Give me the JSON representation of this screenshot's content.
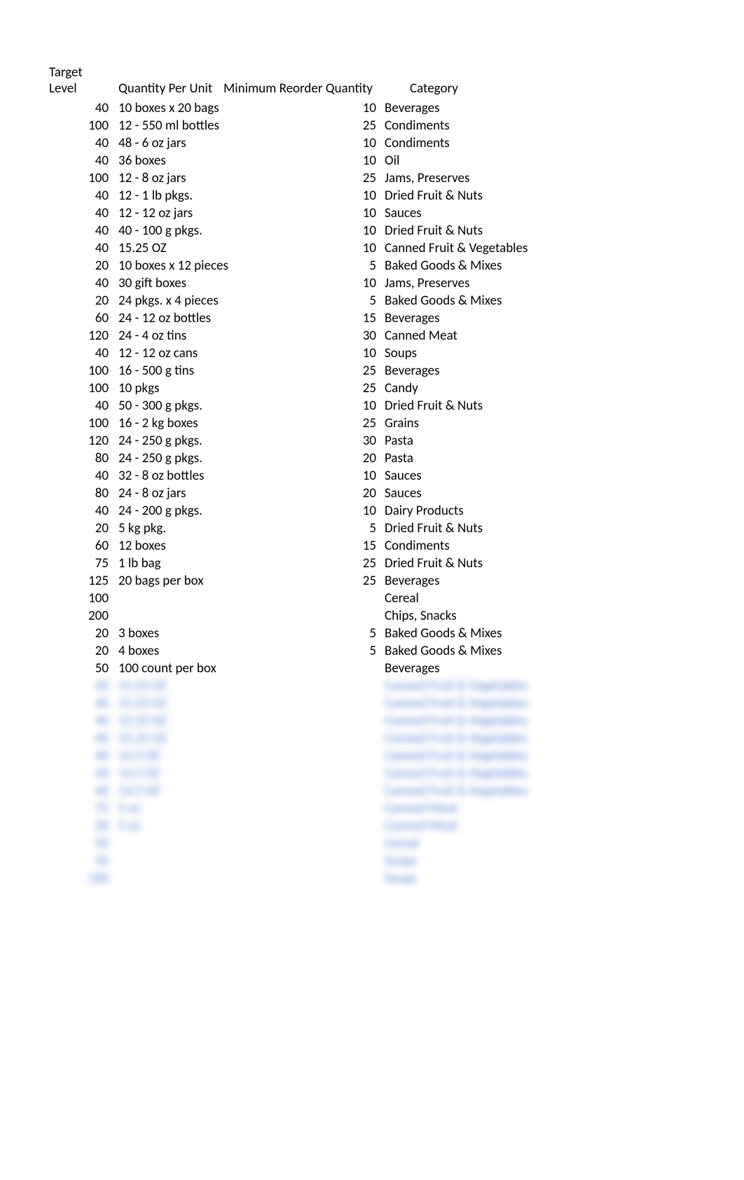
{
  "headers": {
    "target_level": "Target Level",
    "quantity_per_unit": "Quantity Per Unit",
    "min_reorder_qty": "Minimum Reorder Quantity",
    "category": "Category"
  },
  "rows": [
    {
      "target": "40",
      "qpu": "10 boxes x 20 bags",
      "mrq": "10",
      "cat": "Beverages",
      "b": false
    },
    {
      "target": "100",
      "qpu": "12 - 550 ml bottles",
      "mrq": "25",
      "cat": "Condiments",
      "b": false
    },
    {
      "target": "40",
      "qpu": "48 - 6 oz jars",
      "mrq": "10",
      "cat": "Condiments",
      "b": false
    },
    {
      "target": "40",
      "qpu": "36 boxes",
      "mrq": "10",
      "cat": "Oil",
      "b": false
    },
    {
      "target": "100",
      "qpu": "12 - 8 oz jars",
      "mrq": "25",
      "cat": "Jams, Preserves",
      "b": false
    },
    {
      "target": "40",
      "qpu": "12 - 1 lb pkgs.",
      "mrq": "10",
      "cat": "Dried Fruit & Nuts",
      "b": false
    },
    {
      "target": "40",
      "qpu": "12 - 12 oz jars",
      "mrq": "10",
      "cat": "Sauces",
      "b": false
    },
    {
      "target": "40",
      "qpu": "40 - 100 g pkgs.",
      "mrq": "10",
      "cat": "Dried Fruit & Nuts",
      "b": false
    },
    {
      "target": "40",
      "qpu": "15.25 OZ",
      "mrq": "10",
      "cat": "Canned Fruit & Vegetables",
      "b": false
    },
    {
      "target": "20",
      "qpu": "10 boxes x 12 pieces",
      "mrq": "5",
      "cat": "Baked Goods & Mixes",
      "b": false
    },
    {
      "target": "40",
      "qpu": "30 gift boxes",
      "mrq": "10",
      "cat": "Jams, Preserves",
      "b": false
    },
    {
      "target": "20",
      "qpu": "24 pkgs. x 4 pieces",
      "mrq": "5",
      "cat": "Baked Goods & Mixes",
      "b": false
    },
    {
      "target": "60",
      "qpu": "24 - 12 oz bottles",
      "mrq": "15",
      "cat": "Beverages",
      "b": false
    },
    {
      "target": "120",
      "qpu": "24 - 4 oz tins",
      "mrq": "30",
      "cat": "Canned Meat",
      "b": false
    },
    {
      "target": "40",
      "qpu": "12 - 12 oz cans",
      "mrq": "10",
      "cat": "Soups",
      "b": false
    },
    {
      "target": "100",
      "qpu": "16 - 500 g tins",
      "mrq": "25",
      "cat": "Beverages",
      "b": false
    },
    {
      "target": "100",
      "qpu": "10 pkgs",
      "mrq": "25",
      "cat": "Candy",
      "b": false
    },
    {
      "target": "40",
      "qpu": "50 - 300 g pkgs.",
      "mrq": "10",
      "cat": "Dried Fruit & Nuts",
      "b": false
    },
    {
      "target": "100",
      "qpu": "16 - 2 kg boxes",
      "mrq": "25",
      "cat": "Grains",
      "b": false
    },
    {
      "target": "120",
      "qpu": "24 - 250 g pkgs.",
      "mrq": "30",
      "cat": "Pasta",
      "b": false
    },
    {
      "target": "80",
      "qpu": "24 - 250 g pkgs.",
      "mrq": "20",
      "cat": "Pasta",
      "b": false
    },
    {
      "target": "40",
      "qpu": "32 - 8 oz bottles",
      "mrq": "10",
      "cat": "Sauces",
      "b": false
    },
    {
      "target": "80",
      "qpu": "24 - 8 oz jars",
      "mrq": "20",
      "cat": "Sauces",
      "b": false
    },
    {
      "target": "40",
      "qpu": "24 - 200 g pkgs.",
      "mrq": "10",
      "cat": "Dairy Products",
      "b": false
    },
    {
      "target": "20",
      "qpu": "5 kg pkg.",
      "mrq": "5",
      "cat": "Dried Fruit & Nuts",
      "b": false
    },
    {
      "target": "60",
      "qpu": "12 boxes",
      "mrq": "15",
      "cat": "Condiments",
      "b": false
    },
    {
      "target": "75",
      "qpu": "1 lb bag",
      "mrq": "25",
      "cat": "Dried Fruit & Nuts",
      "b": false
    },
    {
      "target": "125",
      "qpu": "20 bags per box",
      "mrq": "25",
      "cat": "Beverages",
      "b": false
    },
    {
      "target": "100",
      "qpu": "",
      "mrq": "",
      "cat": "Cereal",
      "b": false
    },
    {
      "target": "200",
      "qpu": "",
      "mrq": "",
      "cat": "Chips, Snacks",
      "b": false
    },
    {
      "target": "20",
      "qpu": "3 boxes",
      "mrq": "5",
      "cat": "Baked Goods & Mixes",
      "b": false
    },
    {
      "target": "20",
      "qpu": "4 boxes",
      "mrq": "5",
      "cat": "Baked Goods & Mixes",
      "b": false
    },
    {
      "target": "50",
      "qpu": "100 count per box",
      "mrq": "",
      "cat": "Beverages",
      "b": false
    },
    {
      "target": "40",
      "qpu": "15.25 OZ",
      "mrq": "",
      "cat": "Canned Fruit & Vegetables",
      "b": true
    },
    {
      "target": "40",
      "qpu": "15.25 OZ",
      "mrq": "",
      "cat": "Canned Fruit & Vegetables",
      "b": true
    },
    {
      "target": "40",
      "qpu": "15.25 OZ",
      "mrq": "",
      "cat": "Canned Fruit & Vegetables",
      "b": true
    },
    {
      "target": "40",
      "qpu": "15.25 OZ",
      "mrq": "",
      "cat": "Canned Fruit & Vegetables",
      "b": true
    },
    {
      "target": "40",
      "qpu": "14.5 OZ",
      "mrq": "",
      "cat": "Canned Fruit & Vegetables",
      "b": true
    },
    {
      "target": "40",
      "qpu": "14.5 OZ",
      "mrq": "",
      "cat": "Canned Fruit & Vegetables",
      "b": true
    },
    {
      "target": "40",
      "qpu": "14.5 OZ",
      "mrq": "",
      "cat": "Canned Fruit & Vegetables",
      "b": true
    },
    {
      "target": "75",
      "qpu": "5 oz",
      "mrq": "",
      "cat": "Canned Meat",
      "b": true
    },
    {
      "target": "20",
      "qpu": "5 oz",
      "mrq": "",
      "cat": "Canned Meat",
      "b": true
    },
    {
      "target": "50",
      "qpu": "",
      "mrq": "",
      "cat": "Cereal",
      "b": true
    },
    {
      "target": "50",
      "qpu": "",
      "mrq": "",
      "cat": "Soups",
      "b": true
    },
    {
      "target": "100",
      "qpu": "",
      "mrq": "",
      "cat": "Soups",
      "b": true
    }
  ]
}
